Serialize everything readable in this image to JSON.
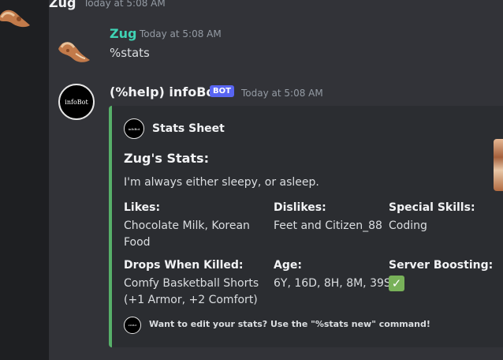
{
  "messages": [
    {
      "author": "Zug",
      "timestamp": "Today at 5:08 AM",
      "avatar_icon": "fried-food-avatar-icon"
    },
    {
      "author": "Zug",
      "timestamp": "Today at 5:08 AM",
      "text": "%stats",
      "avatar_icon": "fried-food-avatar-icon"
    },
    {
      "author": "(%help) infoBot",
      "badge": "BOT",
      "timestamp": "Today at 5:08 AM",
      "avatar_label": "infoBot"
    }
  ],
  "embed": {
    "accent_color": "#57b069",
    "author_name": "Stats Sheet",
    "title": "Zug's Stats:",
    "description": "I'm always either sleepy, or asleep.",
    "fields": [
      {
        "name": "Likes:",
        "value": "Chocolate Milk, Korean Food"
      },
      {
        "name": "Dislikes:",
        "value": "Feet and Citizen_88"
      },
      {
        "name": "Special Skills:",
        "value": "Coding"
      },
      {
        "name": "Drops When Killed:",
        "value": "Comfy Basketball Shorts (+1 Armor, +2 Comfort)"
      },
      {
        "name": "Age:",
        "value": "6Y, 16D, 8H, 8M, 39S"
      },
      {
        "name": "Server Boosting:",
        "value": "✓"
      }
    ],
    "footer": "Want to edit your stats? Use the \"%stats new\" command!"
  },
  "colors": {
    "zug_name": "#3fd3b4",
    "bot_name": "#f2f3f5",
    "badge": "#5865f2",
    "background": "#323338"
  }
}
